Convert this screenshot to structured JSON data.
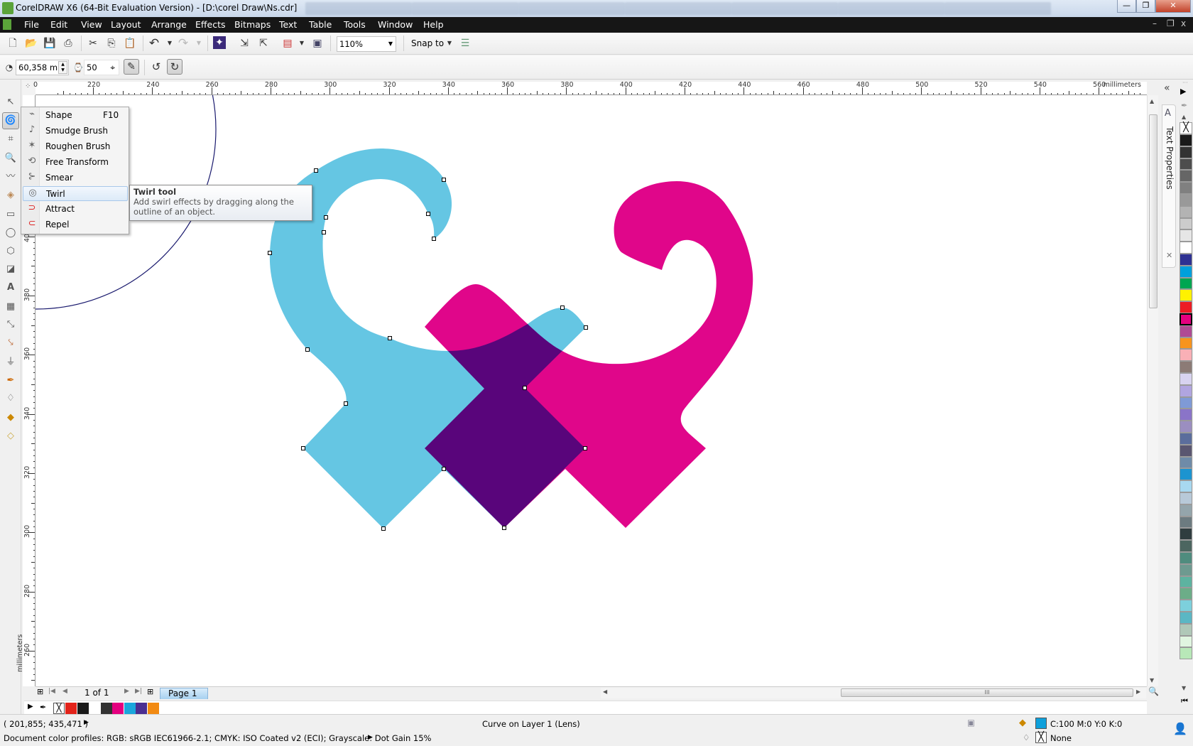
{
  "window": {
    "title": "CorelDRAW X6 (64-Bit Evaluation Version) - [D:\\corel Draw\\Ns.cdr]",
    "minimize": "—",
    "restore": "❐",
    "close": "✕"
  },
  "menu": [
    "File",
    "Edit",
    "View",
    "Layout",
    "Arrange",
    "Effects",
    "Bitmaps",
    "Text",
    "Table",
    "Tools",
    "Window",
    "Help"
  ],
  "toolbar": {
    "zoom_level": "110%",
    "snap_to": "Snap to"
  },
  "property_bar": {
    "size_value": "60,358 mm",
    "speed_value": "50"
  },
  "rulers": {
    "unit": "millimeters",
    "top_origin_label": "0",
    "top_labels": [
      "220",
      "240",
      "260",
      "280",
      "300",
      "320",
      "340",
      "360",
      "380",
      "400",
      "420",
      "440",
      "460",
      "480",
      "500",
      "520",
      "540",
      "560"
    ],
    "left_labels": [
      "400",
      "380",
      "360",
      "340",
      "320",
      "300",
      "280",
      "260"
    ]
  },
  "flyout": {
    "items": [
      {
        "label": "Shape",
        "shortcut": "F10",
        "icon": "shape-tool-icon"
      },
      {
        "label": "Smudge Brush",
        "shortcut": "",
        "icon": "smudge-brush-icon"
      },
      {
        "label": "Roughen Brush",
        "shortcut": "",
        "icon": "roughen-brush-icon"
      },
      {
        "label": "Free Transform",
        "shortcut": "",
        "icon": "free-transform-icon"
      },
      {
        "label": "Smear",
        "shortcut": "",
        "icon": "smear-icon"
      },
      {
        "label": "Twirl",
        "shortcut": "",
        "icon": "twirl-icon",
        "highlighted": true
      },
      {
        "label": "Attract",
        "shortcut": "",
        "icon": "attract-icon"
      },
      {
        "label": "Repel",
        "shortcut": "",
        "icon": "repel-icon"
      }
    ]
  },
  "tooltip": {
    "title": "Twirl tool",
    "body": "Add swirl effects by dragging along the outline of an object."
  },
  "docker": {
    "collapse": "«",
    "tab_label": "Text Properties",
    "close": "✕"
  },
  "page_nav": {
    "count": "1 of 1",
    "page_tab": "Page 1"
  },
  "colors": {
    "cyan_shape": "#65c6e3",
    "magenta_shape": "#e0068a",
    "guide_circle": "#1a1a6e",
    "fill_swatch": "#0fa0db"
  },
  "document_palette": [
    "#e2231a",
    "#1a1a1a",
    "#ffffff",
    "#333333",
    "#e4007f",
    "#1aa6dc",
    "#4b2e91",
    "#f28a12"
  ],
  "color_palette": [
    "#1a1a1a",
    "#333333",
    "#4d4d4d",
    "#666666",
    "#808080",
    "#999999",
    "#b3b3b3",
    "#cccccc",
    "#e6e6e6",
    "#ffffff",
    "#2e3192",
    "#00a0dc",
    "#00a651",
    "#fff200",
    "#ed1c24",
    "#e4007f",
    "#b04a94",
    "#f7941d",
    "#f9b0b6",
    "#8c7b76",
    "#d8d3f0",
    "#b1a5e0",
    "#7f9ad6",
    "#8a74c8",
    "#9b8ec0",
    "#5b6d9c",
    "#5a5670",
    "#6f8ba8",
    "#1c94d0",
    "#a8d8f0",
    "#b8c9d8",
    "#94a5ab",
    "#6c7b80",
    "#2f3d3f",
    "#4c6660",
    "#4f8c7e",
    "#6e9a90",
    "#5db3a0",
    "#6cad88",
    "#7dd0dc",
    "#5bb7c4",
    "#b0c8b8",
    "#e0f5e0",
    "#b8e8b8"
  ],
  "status": {
    "coordinates": "( 201,855; 435,471 )",
    "object_info": "Curve on Layer 1  (Lens)",
    "fill": "C:100 M:0 Y:0 K:0",
    "outline": "None",
    "color_profiles": "Document color profiles: RGB: sRGB IEC61966-2.1; CMYK: ISO Coated v2 (ECI); Grayscale: Dot Gain 15%"
  }
}
